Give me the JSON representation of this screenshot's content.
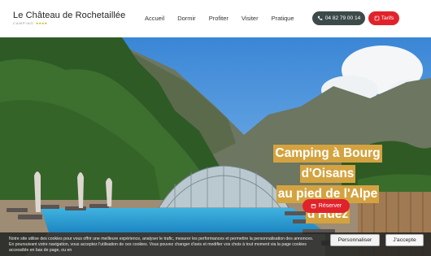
{
  "header": {
    "brand_name": "Le Château de Rochetaillée",
    "brand_sub": "CAMPING",
    "brand_stars": "★★★★",
    "nav": [
      "Accueil",
      "Dormir",
      "Profiter",
      "Visiter",
      "Pratique"
    ],
    "phone": "04 82 79 00 14",
    "tarifs": "Tarifs"
  },
  "hero": {
    "lines": [
      "Camping à Bourg",
      "d'Oisans",
      "au pied de l'Alpe",
      "d'Huez"
    ],
    "reserve": "Réserver"
  },
  "cookie": {
    "text": "Notre site utilise des cookies pour vous offrir une meilleure expérience, analyser le trafic, mesurer les performances et permettre la personnalisation des annonces. En poursuivant votre navigation, vous acceptez l'utilisation de ces cookies. Vous pouvez changer d'avis et modifier vos choix à tout moment via la page cookies accessible en bas de page, ou en",
    "personalize": "Personnaliser",
    "accept": "J'accepte"
  },
  "colors": {
    "accent_red": "#e0232b",
    "title_gold": "#d4a33f",
    "phone_bg": "#3d4a4a"
  }
}
